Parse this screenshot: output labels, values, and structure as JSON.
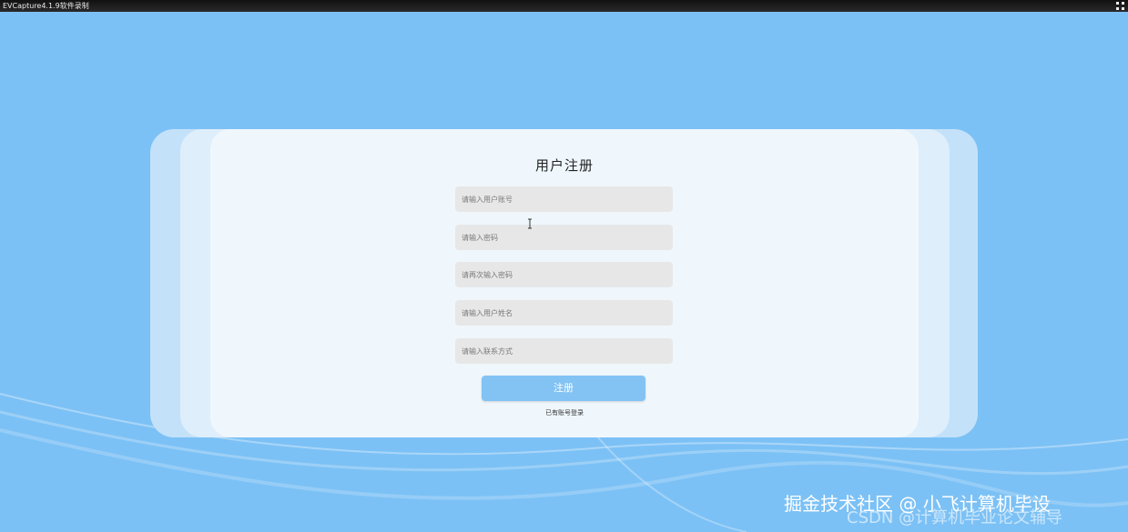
{
  "window": {
    "title": "EVCapture4.1.9软件录制"
  },
  "form": {
    "title": "用户注册",
    "fields": [
      {
        "placeholder": "请输入用户账号"
      },
      {
        "placeholder": "请输入密码"
      },
      {
        "placeholder": "请再次输入密码"
      },
      {
        "placeholder": "请输入用户姓名"
      },
      {
        "placeholder": "请输入联系方式"
      }
    ],
    "submit_label": "注册",
    "login_link": "已有账号登录"
  },
  "watermarks": {
    "primary": "掘金技术社区 @ 小飞计算机毕设",
    "secondary": "CSDN @计算机毕业论文辅导"
  },
  "colors": {
    "background": "#7cc1f5",
    "card": "#eff7fd",
    "field": "#e7e7e7",
    "button": "#82c3f4"
  }
}
